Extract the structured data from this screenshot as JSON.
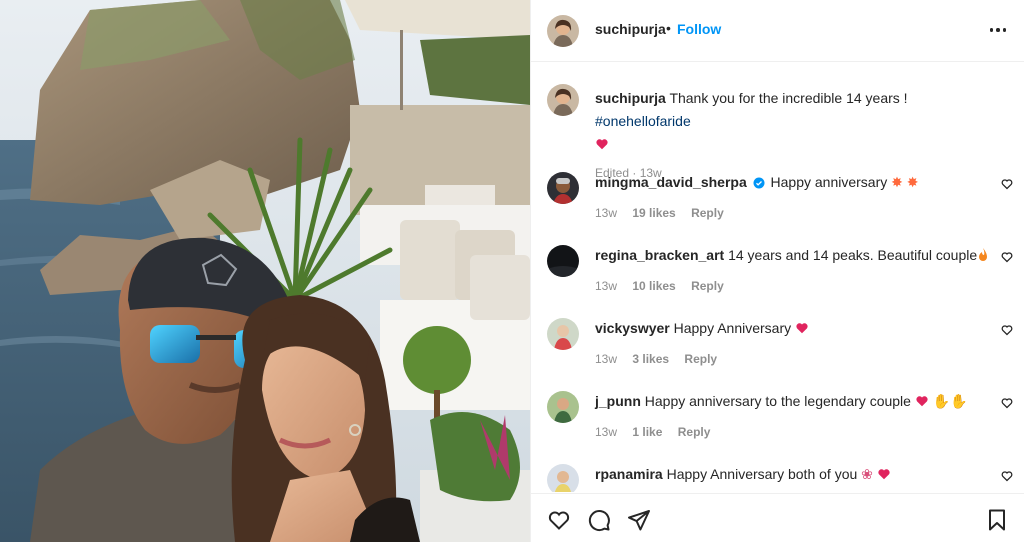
{
  "header": {
    "username": "suchipurja",
    "separator": "•",
    "follow_label": "Follow",
    "more_icon": "more-options-icon"
  },
  "caption": {
    "username": "suchipurja",
    "text": "Thank you for the incredible 14 years ! ",
    "hashtag": "#onehellofaride",
    "emoji": "red-heart",
    "meta": "Edited · 13w"
  },
  "comments": [
    {
      "username": "mingma_david_sherpa",
      "verified": true,
      "text": "Happy anniversary",
      "emoji": "collision-collision",
      "time": "13w",
      "likes": "19 likes",
      "reply": "Reply"
    },
    {
      "username": "regina_bracken_art",
      "verified": false,
      "text": "14 years and 14 peaks. Beautiful couple",
      "emoji": "fire",
      "time": "13w",
      "likes": "10 likes",
      "reply": "Reply"
    },
    {
      "username": "vickyswyer",
      "verified": false,
      "text": "Happy Anniversary",
      "emoji": "red-heart",
      "time": "13w",
      "likes": "3 likes",
      "reply": "Reply"
    },
    {
      "username": "j_punn",
      "verified": false,
      "text": "Happy anniversary to the legendary couple",
      "emoji": "red-heart-raised-hands",
      "time": "13w",
      "likes": "1 like",
      "reply": "Reply"
    },
    {
      "username": "rpanamira",
      "verified": false,
      "text": "Happy Anniversary both of you",
      "emoji": "bouquet-red-heart",
      "time": "",
      "likes": "",
      "reply": ""
    }
  ],
  "actions": {
    "like_icon": "heart-icon",
    "comment_icon": "comment-icon",
    "share_icon": "share-icon",
    "save_icon": "bookmark-icon"
  },
  "colors": {
    "accent": "#0095f6",
    "hashtag": "#00376b",
    "secondary_text": "#8e8e8e",
    "heart": "#ed4956"
  }
}
